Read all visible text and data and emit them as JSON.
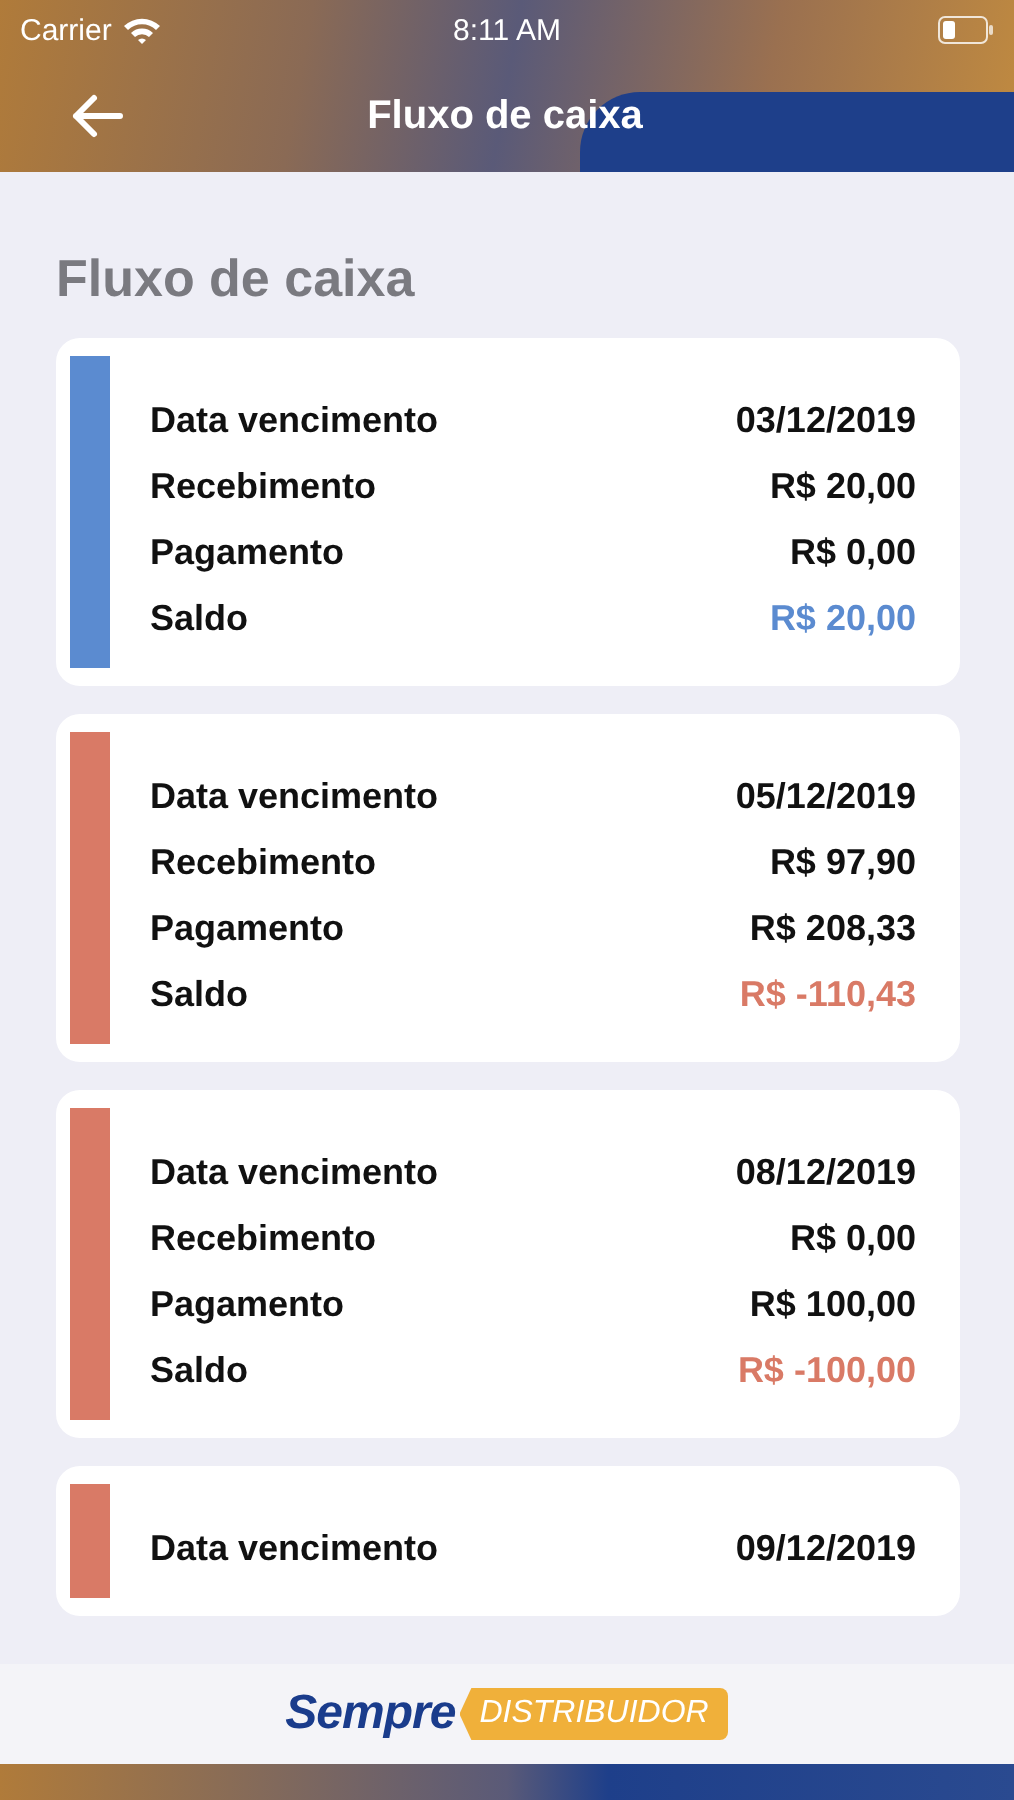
{
  "status_bar": {
    "carrier": "Carrier",
    "time": "8:11 AM"
  },
  "nav": {
    "title": "Fluxo de caixa"
  },
  "page_title": "Fluxo de caixa",
  "cards": [
    {
      "color": "#5b8bd0",
      "rows": [
        {
          "kind": "plain",
          "label": "Data vencimento",
          "value": "03/12/2019"
        },
        {
          "kind": "plain",
          "label": "Recebimento",
          "value": "R$ 20,00"
        },
        {
          "kind": "plain",
          "label": "Pagamento",
          "value": "R$ 0,00"
        },
        {
          "kind": "total",
          "label": "Saldo",
          "value": "R$ 20,00"
        }
      ]
    },
    {
      "color": "#d97a66",
      "rows": [
        {
          "kind": "plain",
          "label": "Data vencimento",
          "value": "05/12/2019"
        },
        {
          "kind": "plain",
          "label": "Recebimento",
          "value": "R$ 97,90"
        },
        {
          "kind": "plain",
          "label": "Pagamento",
          "value": "R$ 208,33"
        },
        {
          "kind": "total",
          "label": "Saldo",
          "value": "R$ -110,43"
        }
      ]
    },
    {
      "color": "#d97a66",
      "rows": [
        {
          "kind": "plain",
          "label": "Data vencimento",
          "value": "08/12/2019"
        },
        {
          "kind": "plain",
          "label": "Recebimento",
          "value": "R$ 0,00"
        },
        {
          "kind": "plain",
          "label": "Pagamento",
          "value": "R$ 100,00"
        },
        {
          "kind": "total",
          "label": "Saldo",
          "value": "R$ -100,00"
        }
      ]
    },
    {
      "color": "#d97a66",
      "rows": [
        {
          "kind": "plain",
          "label": "Data vencimento",
          "value": "09/12/2019"
        }
      ]
    }
  ],
  "footer": {
    "brand": "Sempre",
    "tag": "DISTRIBUIDOR"
  }
}
